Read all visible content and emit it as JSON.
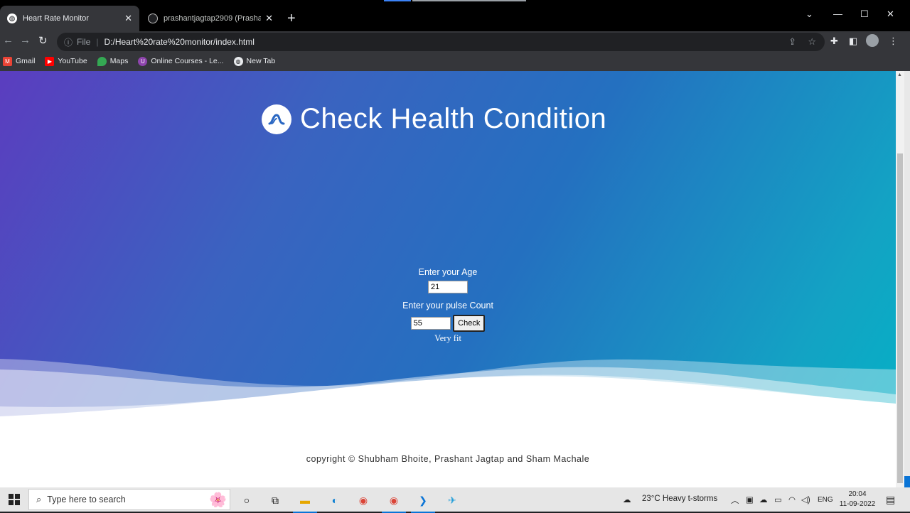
{
  "browser": {
    "tabs": [
      {
        "label": "Heart Rate Monitor",
        "active": true
      },
      {
        "label": "prashantjagtap2909 (Prashant Ja",
        "active": false
      }
    ],
    "address": {
      "scheme_label": "File",
      "url": "D:/Heart%20rate%20monitor/index.html"
    },
    "bookmarks": [
      {
        "label": "Gmail",
        "icon": "gmail-icon",
        "color": "#ea4335"
      },
      {
        "label": "YouTube",
        "icon": "youtube-icon",
        "color": "#ff0000"
      },
      {
        "label": "Maps",
        "icon": "maps-icon",
        "color": "#34a853"
      },
      {
        "label": "Online Courses - Le...",
        "icon": "courses-icon",
        "color": "#8e44ad"
      },
      {
        "label": "New Tab",
        "icon": "newtab-icon",
        "color": "#e8eaed"
      }
    ]
  },
  "page": {
    "title": "Check Health Condition",
    "age_label": "Enter your Age",
    "age_value": "21",
    "pulse_label": "Enter your pulse Count",
    "pulse_value": "55",
    "check_label": "Check",
    "result": "Very fit",
    "copyright": "copyright © Shubham Bhoite, Prashant Jagtap and Sham Machale",
    "gradient_colors": [
      "#5b3dbf",
      "#2470c0",
      "#02b3c6"
    ]
  },
  "taskbar": {
    "search_placeholder": "Type here to search",
    "weather": "23°C  Heavy t-storms",
    "language": "ENG",
    "time": "20:04",
    "date": "11-09-2022"
  }
}
